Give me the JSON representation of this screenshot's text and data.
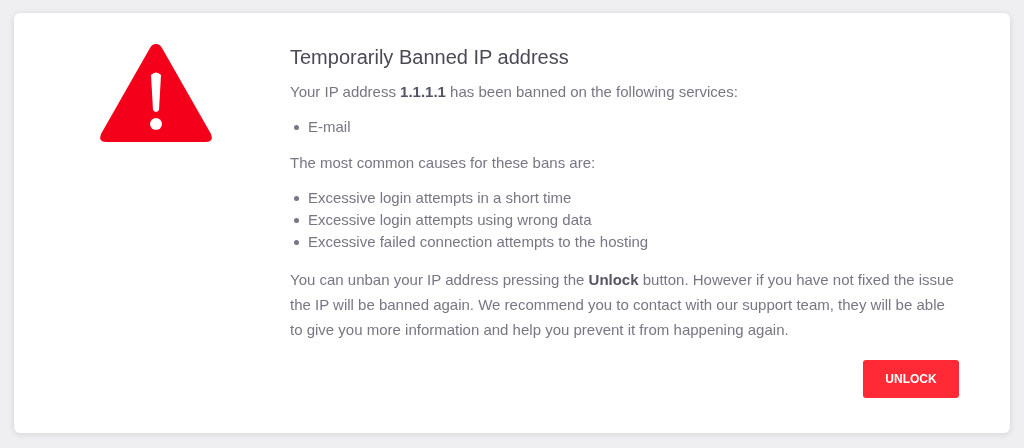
{
  "title": "Temporarily Banned IP address",
  "intro": "Your IP address **1.1.1.1** has been banned on the following services:",
  "services": [
    "E-mail"
  ],
  "causes_intro": "The most common causes for these bans are:",
  "causes": [
    "Excessive login attempts in a short time",
    "Excessive login attempts using wrong data",
    "Excessive failed connection attempts to the hosting"
  ],
  "explanation": "You can unban your IP address pressing the **Unlock** button. However if you have not fixed the issue the IP will be banned again. We recommend you to contact with our support team, they will be able to give you more information and help you prevent it from happening again.",
  "button": "UNLOCK"
}
